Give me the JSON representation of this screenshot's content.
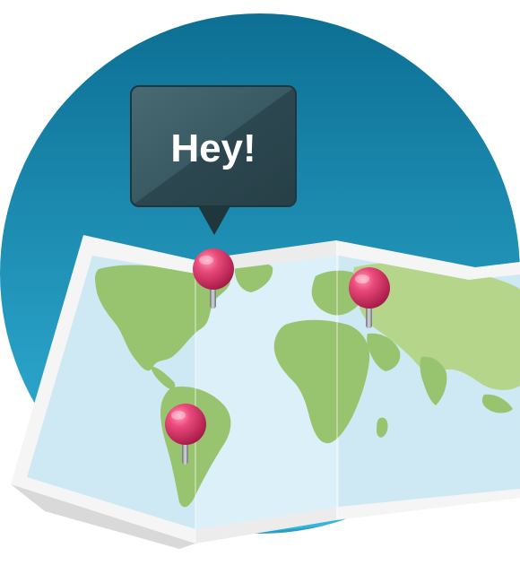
{
  "callout": {
    "text": "Hey!"
  },
  "colors": {
    "circle_top": "#0d6f94",
    "circle_bottom": "#35b6dc",
    "map_frame": "#f2f2f2",
    "ocean": "#d6eef7",
    "land": "#98c36f",
    "land_light": "#b4d58a",
    "bubble": "#2f4b55",
    "pin_head": "#e03a6a",
    "pin_needle": "#8a8f94"
  },
  "icons": {
    "background": "circle-badge",
    "map": "folded-world-map-icon",
    "pins": [
      "map-pin-icon",
      "map-pin-icon",
      "map-pin-icon"
    ]
  }
}
